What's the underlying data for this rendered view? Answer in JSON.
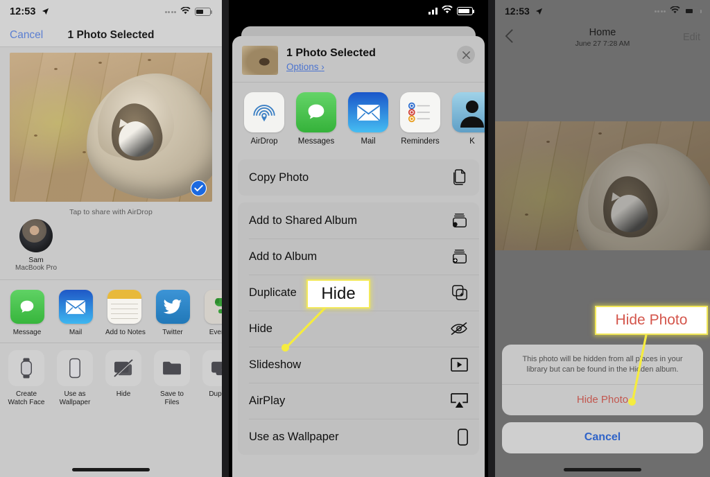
{
  "panel1": {
    "name": "share-sheet-legacy",
    "status": {
      "time": "12:53",
      "location_icon": "location-arrow-icon",
      "wifi_icon": "wifi-icon",
      "battery_icon": "battery-icon"
    },
    "nav": {
      "cancel_label": "Cancel",
      "title": "1 Photo Selected"
    },
    "photo": {
      "alt": "cat-in-bed-photo",
      "selected_badge": "checkmark-icon"
    },
    "airdrop": {
      "hint": "Tap to share with AirDrop",
      "people": [
        {
          "name": "Sam",
          "device": "MacBook Pro"
        }
      ]
    },
    "apps": [
      {
        "label": "Message",
        "icon": "messages-icon"
      },
      {
        "label": "Mail",
        "icon": "mail-icon"
      },
      {
        "label": "Add to Notes",
        "icon": "notes-icon"
      },
      {
        "label": "Twitter",
        "icon": "twitter-icon"
      },
      {
        "label": "Evernot",
        "icon": "evernote-icon"
      }
    ],
    "actions": [
      {
        "label": "Create\nWatch Face",
        "line1": "Create",
        "line2": "Watch Face",
        "icon": "watch-icon"
      },
      {
        "label": "Use as\nWallpaper",
        "line1": "Use as",
        "line2": "Wallpaper",
        "icon": "phone-icon"
      },
      {
        "label": "Hide",
        "line1": "Hide",
        "line2": "",
        "icon": "hide-slash-icon"
      },
      {
        "label": "Save to Files",
        "line1": "Save to Files",
        "line2": "",
        "icon": "folder-icon"
      },
      {
        "label": "Duplica",
        "line1": "Duplica",
        "line2": "",
        "icon": "duplicate-plus-icon"
      }
    ]
  },
  "panel2": {
    "name": "share-sheet-modern",
    "status": {
      "cellular_icon": "cellular-bars-icon",
      "wifi_icon": "wifi-icon",
      "battery_icon": "battery-icon"
    },
    "header": {
      "title": "1 Photo Selected",
      "options_label": "Options",
      "options_chevron": "›",
      "close_icon": "close-x-icon"
    },
    "apps": [
      {
        "label": "AirDrop",
        "icon": "airdrop-icon"
      },
      {
        "label": "Messages",
        "icon": "messages-icon"
      },
      {
        "label": "Mail",
        "icon": "mail-icon"
      },
      {
        "label": "Reminders",
        "icon": "reminders-icon"
      },
      {
        "label": "K",
        "icon": "contact-avatar-icon"
      }
    ],
    "groups": [
      {
        "rows": [
          {
            "label": "Copy Photo",
            "icon": "copy-icon"
          }
        ]
      },
      {
        "rows": [
          {
            "label": "Add to Shared Album",
            "icon": "shared-album-icon"
          },
          {
            "label": "Add to Album",
            "icon": "add-album-icon"
          },
          {
            "label": "Duplicate",
            "icon": "duplicate-icon"
          },
          {
            "label": "Hide",
            "icon": "eye-slash-icon"
          },
          {
            "label": "Slideshow",
            "icon": "play-box-icon"
          },
          {
            "label": "AirPlay",
            "icon": "airplay-icon"
          },
          {
            "label": "Use as Wallpaper",
            "icon": "phone-icon"
          }
        ]
      }
    ]
  },
  "panel3": {
    "name": "photo-detail-confirm",
    "status": {
      "time": "12:53",
      "location_icon": "location-arrow-icon",
      "wifi_icon": "wifi-icon",
      "battery_icon": "battery-icon"
    },
    "nav": {
      "back_icon": "chevron-left-icon",
      "title": "Home",
      "subtitle": "June 27  7:28 AM",
      "edit_label": "Edit"
    },
    "alert": {
      "message": "This photo will be hidden from all places in your library but can be found in the Hidden album.",
      "confirm_label": "Hide Photo",
      "cancel_label": "Cancel"
    }
  },
  "callouts": [
    {
      "id": "callout-hide",
      "text": "Hide",
      "color": "#111111",
      "border": "#f2e85a"
    },
    {
      "id": "callout-hide-photo",
      "text": "Hide Photo",
      "color": "#d4564c",
      "border": "#f2e85a"
    }
  ]
}
